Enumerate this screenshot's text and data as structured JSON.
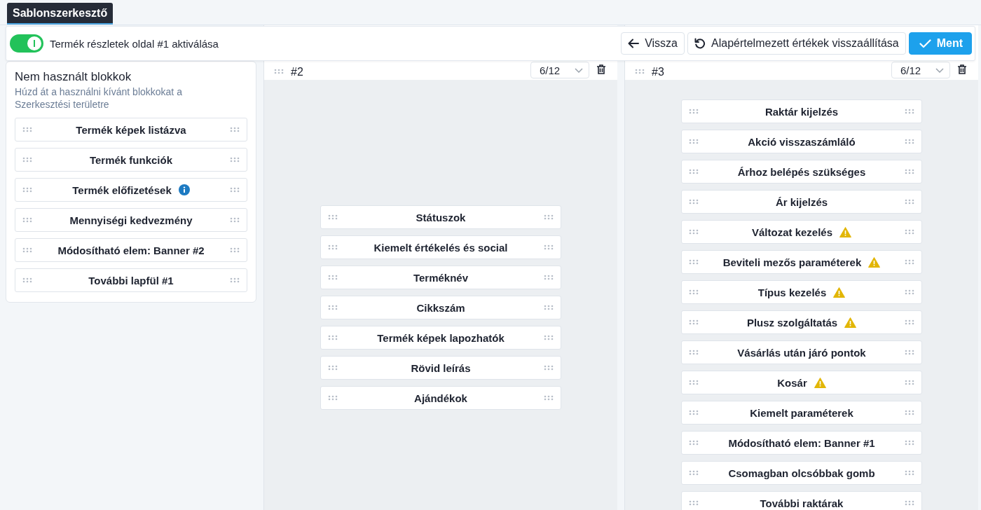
{
  "tab": {
    "label": "Sablonszerkesztő",
    "selected": true
  },
  "toolbar": {
    "toggle": {
      "on": true,
      "label": "Termék részletek oldal #1 aktiválása"
    },
    "buttons": [
      {
        "kind": "back",
        "label": "Vissza"
      },
      {
        "kind": "reset",
        "label": "Alapértelmezett értékek visszaállítása"
      },
      {
        "kind": "save",
        "label": "Ment"
      }
    ]
  },
  "unused_panel": {
    "title": "Nem használt blokkok",
    "hint": "Húzd át a használni kívánt blokkokat a Szerkesztési területre",
    "blocks": [
      {
        "label": "Termék képek listázva"
      },
      {
        "label": "Termék funkciók"
      },
      {
        "label": "Termék előfizetések",
        "kind": "info"
      },
      {
        "label": "Mennyiségi kedvezmény"
      },
      {
        "label": "Módosítható elem: Banner #2"
      },
      {
        "label": "További lapfül #1"
      }
    ]
  },
  "columns": [
    {
      "title": "#2",
      "width": "6/12",
      "blocks": [
        {
          "label": "Státuszok"
        },
        {
          "label": "Kiemelt értékelés és social"
        },
        {
          "label": "Terméknév"
        },
        {
          "label": "Cikkszám"
        },
        {
          "label": "Termék képek lapozhatók"
        },
        {
          "label": "Rövid leírás"
        },
        {
          "label": "Ajándékok"
        }
      ]
    },
    {
      "title": "#3",
      "width": "6/12",
      "blocks": [
        {
          "label": "Raktár kijelzés"
        },
        {
          "label": "Akció visszaszámláló"
        },
        {
          "label": "Árhoz belépés szükséges"
        },
        {
          "label": "Ár kijelzés"
        },
        {
          "label": "Változat kezelés",
          "kind": "warning"
        },
        {
          "label": "Beviteli mezős paraméterek",
          "kind": "warning"
        },
        {
          "label": "Típus kezelés",
          "kind": "warning"
        },
        {
          "label": "Plusz szolgáltatás",
          "kind": "warning"
        },
        {
          "label": "Vásárlás után járó pontok"
        },
        {
          "label": "Kosár",
          "kind": "warning"
        },
        {
          "label": "Kiemelt paraméterek"
        },
        {
          "label": "Módosítható elem: Banner #1"
        },
        {
          "label": "Csomagban olcsóbbak gomb"
        },
        {
          "label": "További raktárak"
        }
      ]
    }
  ]
}
